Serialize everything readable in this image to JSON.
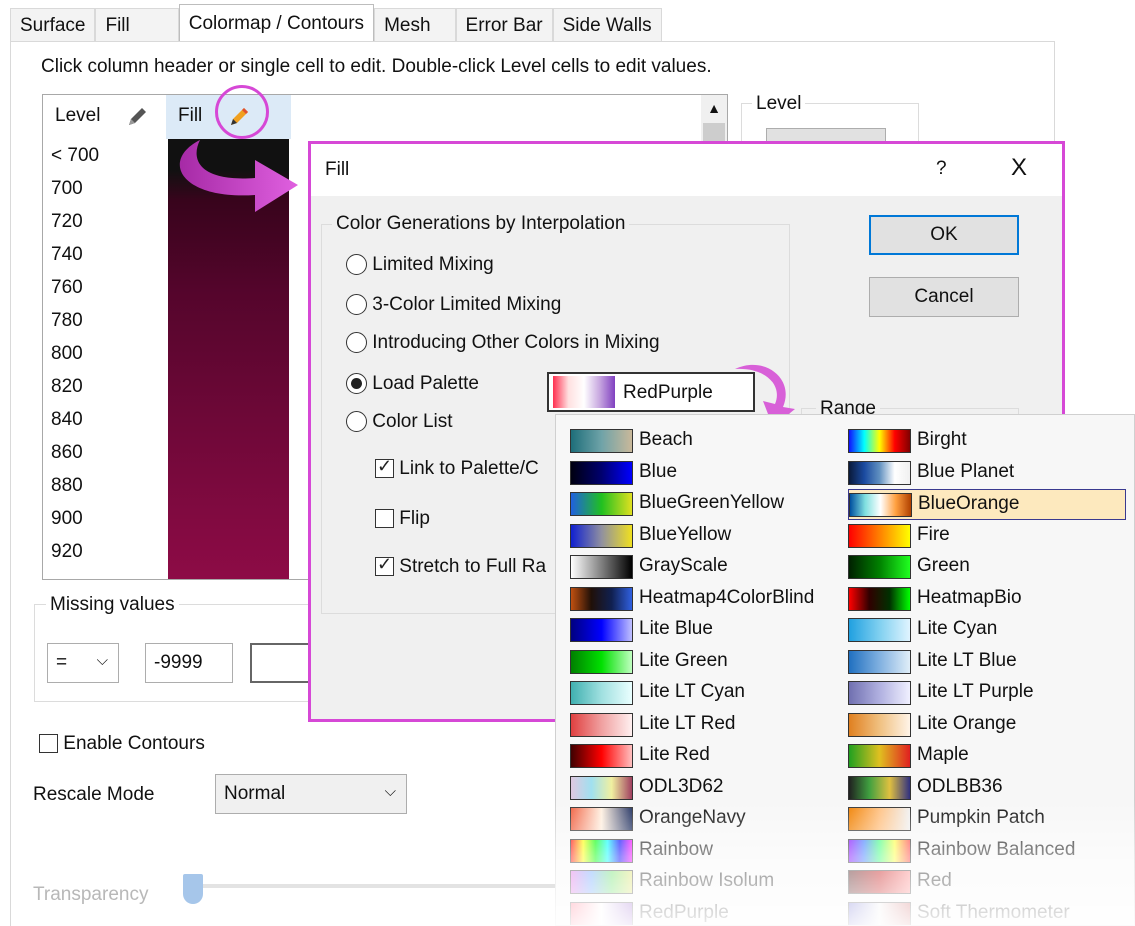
{
  "tabs": [
    "Surface",
    "Fill",
    "Colormap / Contours",
    "Mesh",
    "Error Bar",
    "Side Walls"
  ],
  "hint": "Click column header or single cell to edit. Double-click Level cells to edit values.",
  "table": {
    "col_level": "Level",
    "col_fill": "Fill",
    "levels": [
      "< 700",
      "700",
      "720",
      "740",
      "760",
      "780",
      "800",
      "820",
      "840",
      "860",
      "880",
      "900",
      "920"
    ]
  },
  "level_group_label": "Level",
  "missing": {
    "label": "Missing values",
    "operator": "=",
    "value": "-9999"
  },
  "enable_contours": {
    "label": "Enable Contours",
    "checked": false
  },
  "rescale": {
    "label": "Rescale Mode",
    "value": "Normal"
  },
  "transparency": {
    "label": "Transparency",
    "percent": 0
  },
  "fill_dialog": {
    "title": "Fill",
    "help": "?",
    "close": "X",
    "group_label": "Color Generations by Interpolation",
    "options": [
      {
        "label": "Limited Mixing",
        "selected": false
      },
      {
        "label": "3-Color Limited Mixing",
        "selected": false
      },
      {
        "label": "Introducing Other Colors in Mixing",
        "selected": false
      },
      {
        "label": "Load Palette",
        "selected": true
      },
      {
        "label": "Color List",
        "selected": false
      }
    ],
    "palette": "RedPurple",
    "link": {
      "label": "Link to Palette/C",
      "checked": true
    },
    "flip": {
      "label": "Flip",
      "checked": false
    },
    "stretch": {
      "label": "Stretch to Full Ra",
      "checked": true
    },
    "ok": "OK",
    "cancel": "Cancel",
    "range_label": "Range"
  },
  "palette_list": [
    {
      "name": "Beach",
      "colors": [
        "#1e6e7a",
        "#6fa3a8",
        "#c9b89a"
      ]
    },
    {
      "name": "Birght",
      "colors": [
        "#1010ff",
        "#00ffff",
        "#ffff00",
        "#ff0000",
        "#800000"
      ]
    },
    {
      "name": "Blue",
      "colors": [
        "#000010",
        "#00006e",
        "#0000ff"
      ]
    },
    {
      "name": "Blue Planet",
      "colors": [
        "#0a1a3a",
        "#1a4aa0",
        "#6090c0",
        "#ffffff",
        "#f0f0f0"
      ]
    },
    {
      "name": "BlueGreenYellow",
      "colors": [
        "#2060e0",
        "#20c020",
        "#e0e020"
      ]
    },
    {
      "name": "BlueOrange",
      "colors": [
        "#0050a0",
        "#80e0e0",
        "#ffffff",
        "#ffa040",
        "#b04000"
      ]
    },
    {
      "name": "BlueYellow",
      "colors": [
        "#1020d0",
        "#9090a0",
        "#f0e020"
      ]
    },
    {
      "name": "Fire",
      "colors": [
        "#ff0000",
        "#ff8000",
        "#ffff00"
      ]
    },
    {
      "name": "GrayScale",
      "colors": [
        "#ffffff",
        "#808080",
        "#000000"
      ]
    },
    {
      "name": "Green",
      "colors": [
        "#002000",
        "#008000",
        "#20ff20"
      ]
    },
    {
      "name": "Heatmap4ColorBlind",
      "colors": [
        "#c05010",
        "#201008",
        "#102050",
        "#3060e0"
      ]
    },
    {
      "name": "HeatmapBio",
      "colors": [
        "#ff0000",
        "#300000",
        "#003000",
        "#00ff00"
      ]
    },
    {
      "name": "Lite Blue",
      "colors": [
        "#000080",
        "#0000ff",
        "#c0c0ff"
      ]
    },
    {
      "name": "Lite Cyan",
      "colors": [
        "#20a0e0",
        "#80d0f0",
        "#e0f4ff"
      ]
    },
    {
      "name": "Lite Green",
      "colors": [
        "#008000",
        "#00e000",
        "#c0ffc0"
      ]
    },
    {
      "name": "Lite LT Blue",
      "colors": [
        "#2070c0",
        "#80b0e0",
        "#e0eef8"
      ]
    },
    {
      "name": "Lite LT Cyan",
      "colors": [
        "#40b0b0",
        "#a0e0e0",
        "#eaffff"
      ]
    },
    {
      "name": "Lite LT Purple",
      "colors": [
        "#7070b0",
        "#b0b0e0",
        "#f0f0ff"
      ]
    },
    {
      "name": "Lite LT Red",
      "colors": [
        "#e04040",
        "#f0a0a0",
        "#fff0f0"
      ]
    },
    {
      "name": "Lite Orange",
      "colors": [
        "#e08020",
        "#f0c080",
        "#fff4e8"
      ]
    },
    {
      "name": "Lite Red",
      "colors": [
        "#400000",
        "#ff0000",
        "#ffc0c0"
      ]
    },
    {
      "name": "Maple",
      "colors": [
        "#20a020",
        "#e0c020",
        "#e02020"
      ]
    },
    {
      "name": "ODL3D62",
      "colors": [
        "#e0c8e0",
        "#a0e0f0",
        "#f0f0a0",
        "#a04060"
      ]
    },
    {
      "name": "ODLBB36",
      "colors": [
        "#202020",
        "#40a040",
        "#e0c040",
        "#303080"
      ]
    },
    {
      "name": "OrangeNavy",
      "colors": [
        "#f06040",
        "#fff0e0",
        "#203060"
      ]
    },
    {
      "name": "Pumpkin Patch",
      "colors": [
        "#f08000",
        "#ffc080",
        "#f0f0f0"
      ]
    },
    {
      "name": "Rainbow",
      "colors": [
        "#ff0000",
        "#ffff00",
        "#00ff00",
        "#00ffff",
        "#0000ff",
        "#ff00ff"
      ]
    },
    {
      "name": "Rainbow Balanced",
      "colors": [
        "#8000ff",
        "#4080ff",
        "#40ff80",
        "#ffff40",
        "#ff4040"
      ]
    },
    {
      "name": "Rainbow Isolum",
      "colors": [
        "#e060e0",
        "#60a0ff",
        "#60e060",
        "#e0e060"
      ]
    },
    {
      "name": "Red",
      "colors": [
        "#400000",
        "#c00000",
        "#ff8080"
      ]
    },
    {
      "name": "RedPurple",
      "colors": [
        "#ff4060",
        "#ffffff",
        "#8040c0"
      ]
    },
    {
      "name": "Soft Thermometer",
      "colors": [
        "#4040c0",
        "#f0f0f0",
        "#c04040"
      ]
    }
  ],
  "selected_palette": "BlueOrange",
  "colors": {
    "accent": "#d648d6",
    "selection": "#fde9be",
    "fill_header": "#dceaf7",
    "default_button": "#0078d7"
  }
}
